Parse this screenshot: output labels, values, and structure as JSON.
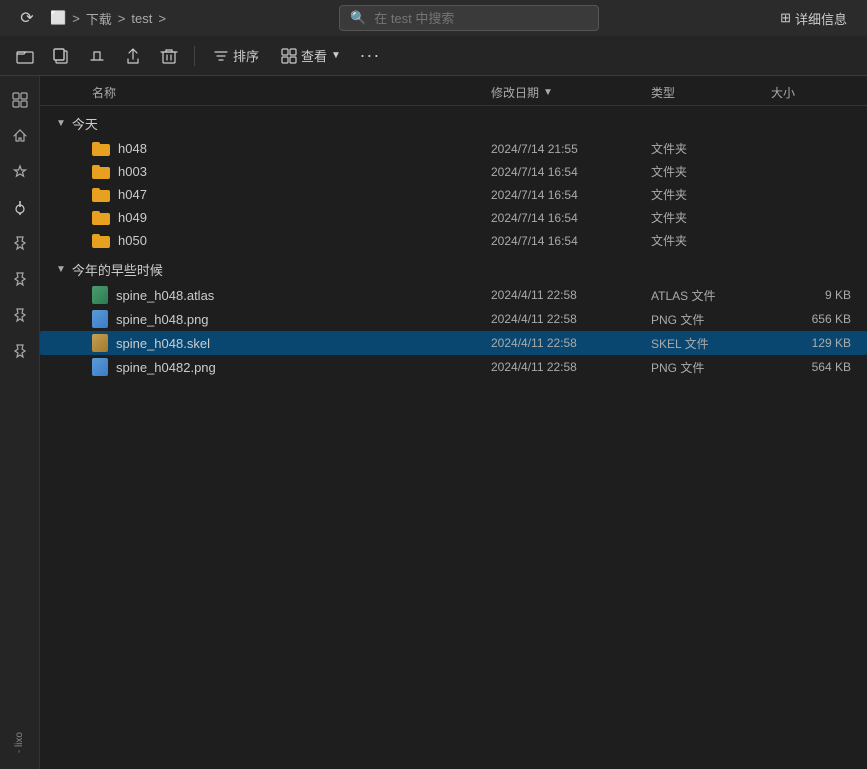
{
  "titleBar": {
    "refreshLabel": "↺",
    "navItems": [
      "下载",
      "test"
    ],
    "chevrons": [
      ">",
      ">",
      ">"
    ],
    "searchPlaceholder": "在 test 中搜索",
    "detailsLabel": "详细信息"
  },
  "toolbar": {
    "buttons": [
      {
        "name": "new-folder-btn",
        "icon": "⊞",
        "label": "新建文件夹"
      },
      {
        "name": "copy-btn",
        "icon": "⧉",
        "label": "复制"
      },
      {
        "name": "rename-btn",
        "icon": "T",
        "label": "重命名"
      },
      {
        "name": "share-btn",
        "icon": "⇪",
        "label": "共享"
      },
      {
        "name": "delete-btn",
        "icon": "⊠",
        "label": "删除"
      }
    ],
    "sortLabel": "排序",
    "viewLabel": "查看",
    "moreLabel": "···"
  },
  "columns": {
    "name": "名称",
    "date": "修改日期",
    "type": "类型",
    "size": "大小"
  },
  "sections": [
    {
      "id": "today",
      "label": "今天",
      "collapsed": false,
      "items": [
        {
          "id": "h048",
          "name": "h048",
          "type": "folder",
          "date": "2024/7/14 21:55",
          "fileType": "文件夹",
          "size": ""
        },
        {
          "id": "h003",
          "name": "h003",
          "type": "folder",
          "date": "2024/7/14 16:54",
          "fileType": "文件夹",
          "size": ""
        },
        {
          "id": "h047",
          "name": "h047",
          "type": "folder",
          "date": "2024/7/14 16:54",
          "fileType": "文件夹",
          "size": ""
        },
        {
          "id": "h049",
          "name": "h049",
          "type": "folder",
          "date": "2024/7/14 16:54",
          "fileType": "文件夹",
          "size": ""
        },
        {
          "id": "h050",
          "name": "h050",
          "type": "folder",
          "date": "2024/7/14 16:54",
          "fileType": "文件夹",
          "size": ""
        }
      ]
    },
    {
      "id": "earlier-this-year",
      "label": "今年的早些时候",
      "collapsed": false,
      "items": [
        {
          "id": "spine_h048_atlas",
          "name": "spine_h048.atlas",
          "type": "atlas",
          "date": "2024/4/11 22:58",
          "fileType": "ATLAS 文件",
          "size": "9 KB"
        },
        {
          "id": "spine_h048_png",
          "name": "spine_h048.png",
          "type": "png",
          "date": "2024/4/11 22:58",
          "fileType": "PNG 文件",
          "size": "656 KB"
        },
        {
          "id": "spine_h048_skel",
          "name": "spine_h048.skel",
          "type": "skel",
          "date": "2024/4/11 22:58",
          "fileType": "SKEL 文件",
          "size": "129 KB",
          "selected": true
        },
        {
          "id": "spine_h0482_png",
          "name": "spine_h0482.png",
          "type": "png",
          "date": "2024/4/11 22:58",
          "fileType": "PNG 文件",
          "size": "564 KB"
        }
      ]
    }
  ],
  "sidebar": {
    "icons": [
      "⊞",
      "◫",
      "⊙",
      "⊕",
      "★",
      "★",
      "★",
      "★"
    ],
    "userLabel": "- lixo"
  }
}
